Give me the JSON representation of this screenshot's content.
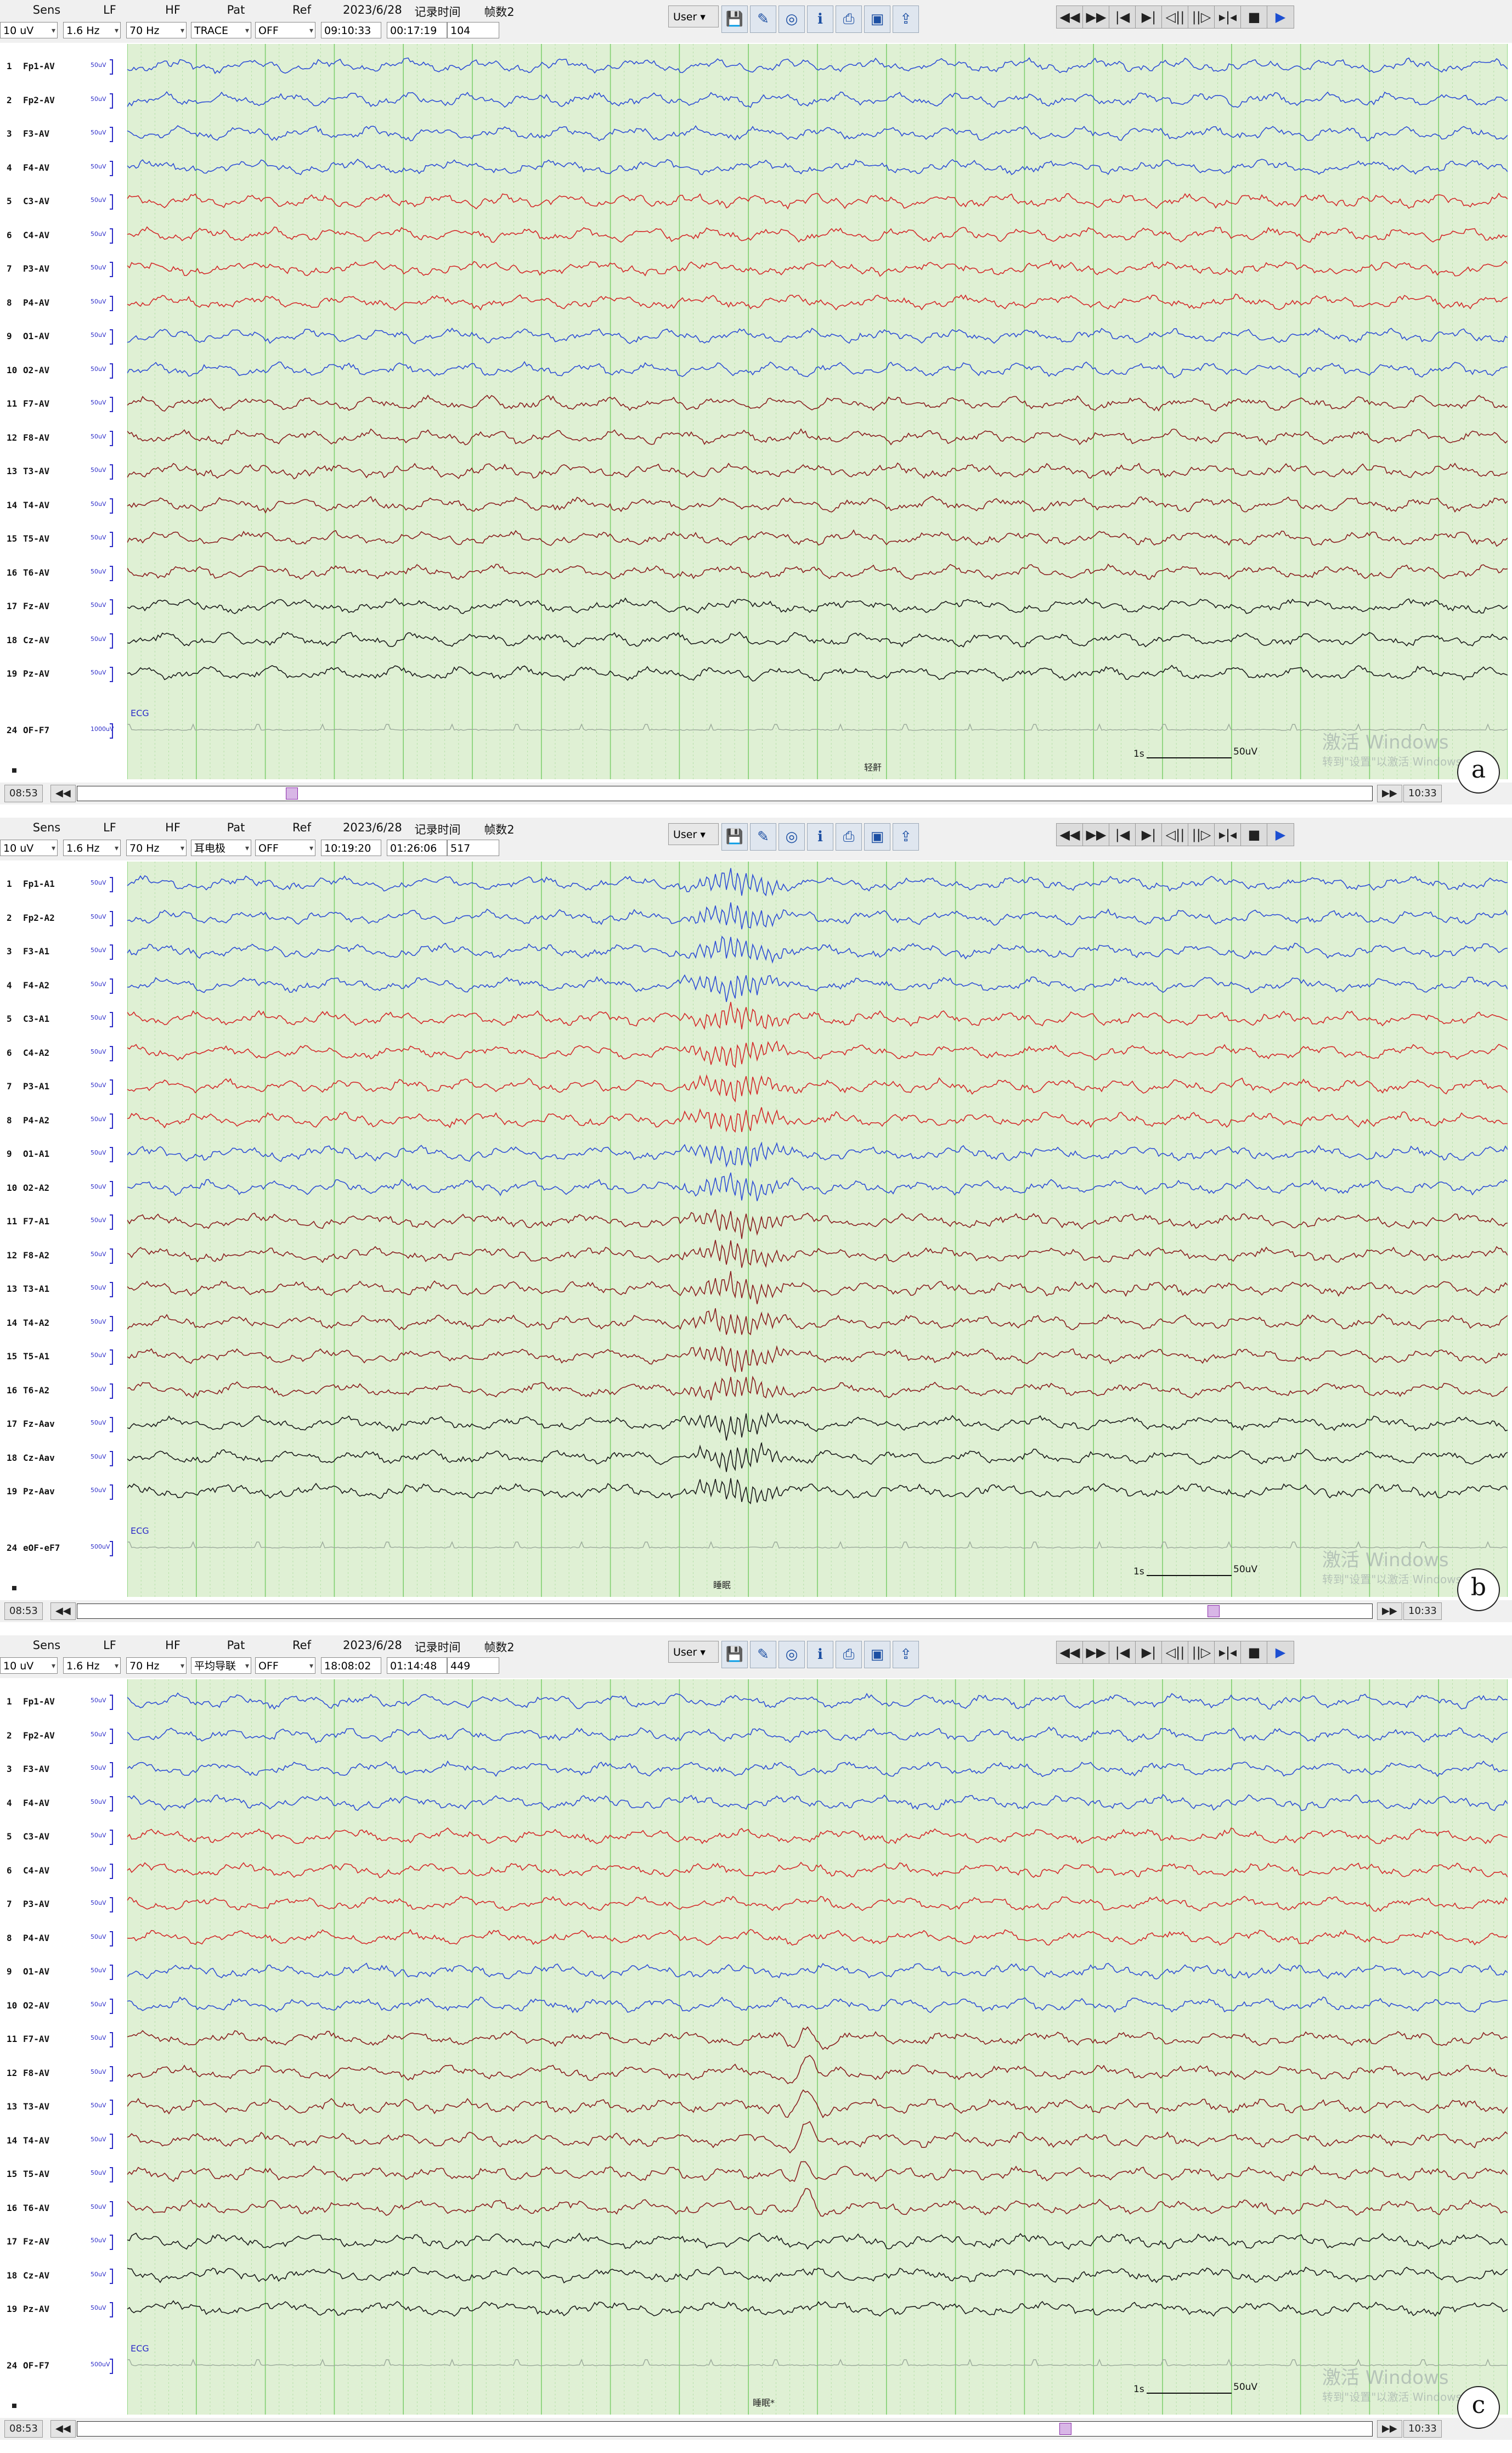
{
  "toolbar_headers": [
    "Sens",
    "LF",
    "HF",
    "Pat",
    "Ref",
    "2023/6/28",
    "记录时间",
    "帧数2"
  ],
  "user_button": "User",
  "common": {
    "sens": "10 uV",
    "lf": "1.6 Hz",
    "hf": "70 Hz",
    "ref": "OFF",
    "start_time": "08:53",
    "end_time": "10:33",
    "calibration": "1s",
    "calibration_amp": "50uV",
    "channel_scale": "50uV",
    "ecg_label": "ECG",
    "watermark": "激活 Windows",
    "watermark_sub": "转到\"设置\"以激活 Windows。"
  },
  "colors": {
    "frontal": "#2f4fd6",
    "central": "#d42a2a",
    "temporal": "#8a1f1f",
    "midline": "#1a1a1a",
    "ecg": "#9aa89a",
    "grid_bg": "#dff0d4",
    "grid_line": "#7fcf6f"
  },
  "panels": [
    {
      "tag": "a",
      "pat": "TRACE",
      "clock": "09:10:33",
      "record_time": "00:17:19",
      "frame": "104",
      "event": "轻鼾",
      "channels": [
        "Fp1-AV",
        "Fp2-AV",
        "F3-AV",
        "F4-AV",
        "C3-AV",
        "C4-AV",
        "P3-AV",
        "P4-AV",
        "O1-AV",
        "O2-AV",
        "F7-AV",
        "F8-AV",
        "T3-AV",
        "T4-AV",
        "T5-AV",
        "T6-AV",
        "Fz-AV",
        "Cz-AV",
        "Pz-AV"
      ],
      "ecg_channel": "OF-F7",
      "ecg_scale": "1000uV"
    },
    {
      "tag": "b",
      "pat": "耳电极",
      "clock": "10:19:20",
      "record_time": "01:26:06",
      "frame": "517",
      "event": "睡眠",
      "channels": [
        "Fp1-A1",
        "Fp2-A2",
        "F3-A1",
        "F4-A2",
        "C3-A1",
        "C4-A2",
        "P3-A1",
        "P4-A2",
        "O1-A1",
        "O2-A2",
        "F7-A1",
        "F8-A2",
        "T3-A1",
        "T4-A2",
        "T5-A1",
        "T6-A2",
        "Fz-Aav",
        "Cz-Aav",
        "Pz-Aav"
      ],
      "ecg_channel": "eOF-eF7",
      "ecg_scale": "500uV"
    },
    {
      "tag": "c",
      "pat": "平均导联",
      "clock": "18:08:02",
      "record_time": "01:14:48",
      "frame": "449",
      "event": "睡眠*",
      "channels": [
        "Fp1-AV",
        "Fp2-AV",
        "F3-AV",
        "F4-AV",
        "C3-AV",
        "C4-AV",
        "P3-AV",
        "P4-AV",
        "O1-AV",
        "O2-AV",
        "F7-AV",
        "F8-AV",
        "T3-AV",
        "T4-AV",
        "T5-AV",
        "T6-AV",
        "Fz-AV",
        "Cz-AV",
        "Pz-AV"
      ],
      "ecg_channel": "OF-F7",
      "ecg_scale": "500uV"
    }
  ],
  "channel_numbers": [
    "1",
    "2",
    "3",
    "4",
    "5",
    "6",
    "7",
    "8",
    "9",
    "10",
    "11",
    "12",
    "13",
    "14",
    "15",
    "16",
    "17",
    "18",
    "19"
  ],
  "ecg_number": "24",
  "channel_color_groups": [
    "frontal",
    "frontal",
    "frontal",
    "frontal",
    "central",
    "central",
    "central",
    "central",
    "frontal",
    "frontal",
    "temporal",
    "temporal",
    "temporal",
    "temporal",
    "temporal",
    "temporal",
    "midline",
    "midline",
    "midline"
  ],
  "media_buttons": [
    "◀◀",
    "▶▶",
    "|◀",
    "▶|",
    "◁||",
    "||▷",
    "▸|◂",
    "■",
    "▶"
  ]
}
